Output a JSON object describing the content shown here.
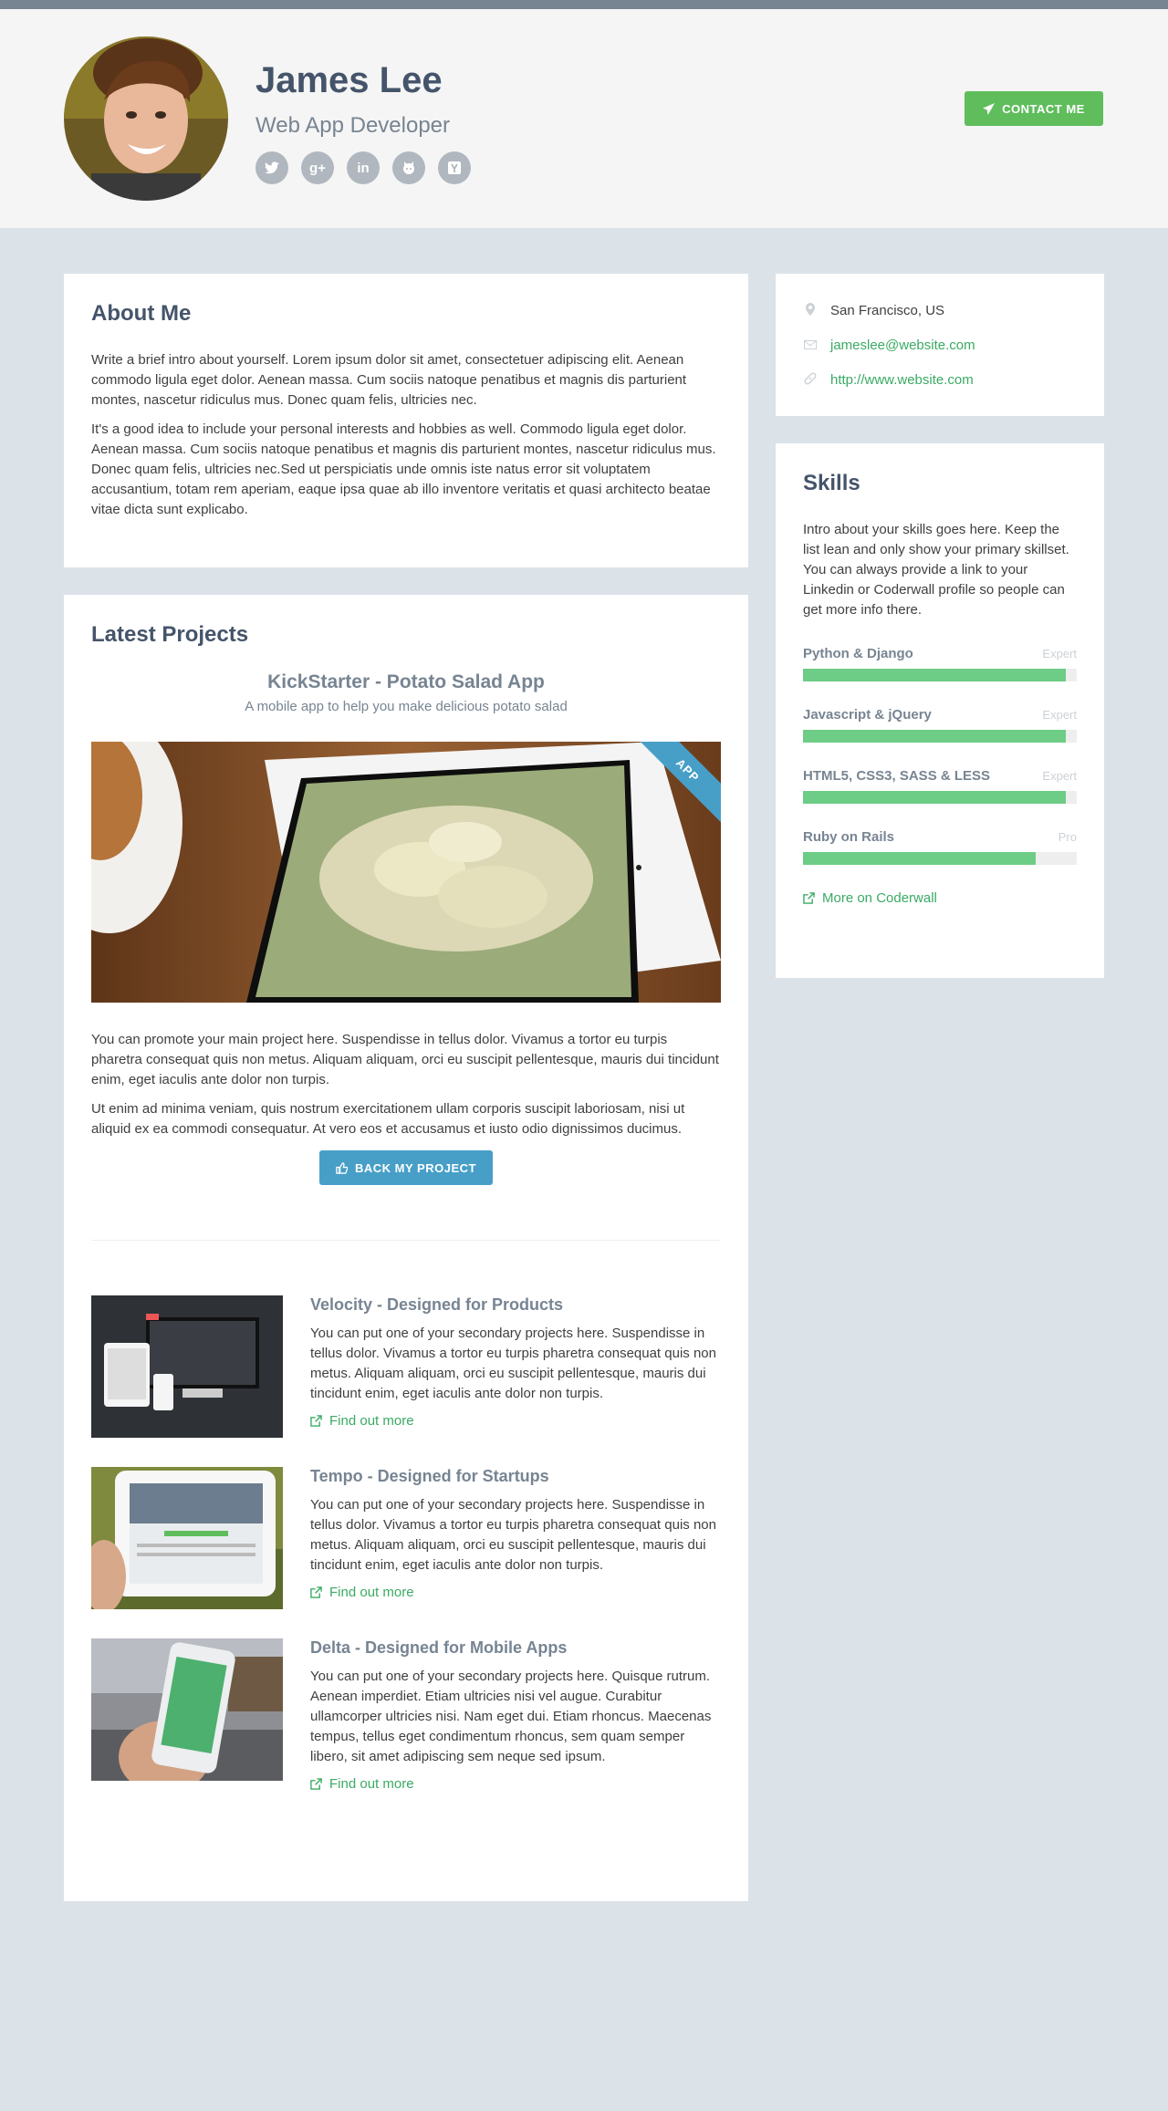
{
  "profile": {
    "name": "James Lee",
    "role": "Web App Developer",
    "social": [
      "twitter",
      "google-plus",
      "linkedin",
      "github",
      "hacker-news"
    ],
    "contact_label": "CONTACT ME"
  },
  "about": {
    "title": "About Me",
    "paragraphs": [
      "Write a brief intro about yourself. Lorem ipsum dolor sit amet, consectetuer adipiscing elit. Aenean commodo ligula eget dolor. Aenean massa. Cum sociis natoque penatibus et magnis dis parturient montes, nascetur ridiculus mus. Donec quam felis, ultricies nec.",
      "It's a good idea to include your personal interests and hobbies as well. Commodo ligula eget dolor. Aenean massa. Cum sociis natoque penatibus et magnis dis parturient montes, nascetur ridiculus mus. Donec quam felis, ultricies nec.Sed ut perspiciatis unde omnis iste natus error sit voluptatem accusantium, totam rem aperiam, eaque ipsa quae ab illo inventore veritatis et quasi architecto beatae vitae dicta sunt explicabo."
    ]
  },
  "projects": {
    "title": "Latest Projects",
    "featured": {
      "title": "KickStarter - Potato Salad App",
      "desc": "A mobile app to help you make delicious potato salad",
      "ribbon": "APP",
      "paragraphs": [
        "You can promote your main project here. Suspendisse in tellus dolor. Vivamus a tortor eu turpis pharetra consequat quis non metus. Aliquam aliquam, orci eu suscipit pellentesque, mauris dui tincidunt enim, eget iaculis ante dolor non turpis.",
        "Ut enim ad minima veniam, quis nostrum exercitationem ullam corporis suscipit laboriosam, nisi ut aliquid ex ea commodi consequatur. At vero eos et accusamus et iusto odio dignissimos ducimus."
      ],
      "button": "BACK MY PROJECT"
    },
    "secondary": [
      {
        "title": "Velocity - Designed for Products",
        "text": "You can put one of your secondary projects here. Suspendisse in tellus dolor. Vivamus a tortor eu turpis pharetra consequat quis non metus. Aliquam aliquam, orci eu suscipit pellentesque, mauris dui tincidunt enim, eget iaculis ante dolor non turpis.",
        "link": "Find out more"
      },
      {
        "title": "Tempo - Designed for Startups",
        "text": "You can put one of your secondary projects here. Suspendisse in tellus dolor. Vivamus a tortor eu turpis pharetra consequat quis non metus. Aliquam aliquam, orci eu suscipit pellentesque, mauris dui tincidunt enim, eget iaculis ante dolor non turpis.",
        "link": "Find out more"
      },
      {
        "title": "Delta - Designed for Mobile Apps",
        "text": "You can put one of your secondary projects here. Quisque rutrum. Aenean imperdiet. Etiam ultricies nisi vel augue. Curabitur ullamcorper ultricies nisi. Nam eget dui. Etiam rhoncus. Maecenas tempus, tellus eget condimentum rhoncus, sem quam semper libero, sit amet adipiscing sem neque sed ipsum.",
        "link": "Find out more"
      }
    ]
  },
  "info": {
    "location": "San Francisco, US",
    "email": "jameslee@website.com",
    "website": "http://www.website.com"
  },
  "skills": {
    "title": "Skills",
    "intro": "Intro about your skills goes here. Keep the list lean and only show your primary skillset. You can always provide a link to your Linkedin or Coderwall profile so people can get more info there.",
    "items": [
      {
        "name": "Python & Django",
        "level": "Expert",
        "percent": 96
      },
      {
        "name": "Javascript & jQuery",
        "level": "Expert",
        "percent": 96
      },
      {
        "name": "HTML5, CSS3, SASS & LESS",
        "level": "Expert",
        "percent": 96
      },
      {
        "name": "Ruby on Rails",
        "level": "Pro",
        "percent": 85
      }
    ],
    "more": "More on Coderwall"
  },
  "colors": {
    "accent_green": "#3aaa64",
    "accent_blue": "#479fc8",
    "bar_green": "#6dcc86",
    "page_bg": "#dbe2e8"
  }
}
